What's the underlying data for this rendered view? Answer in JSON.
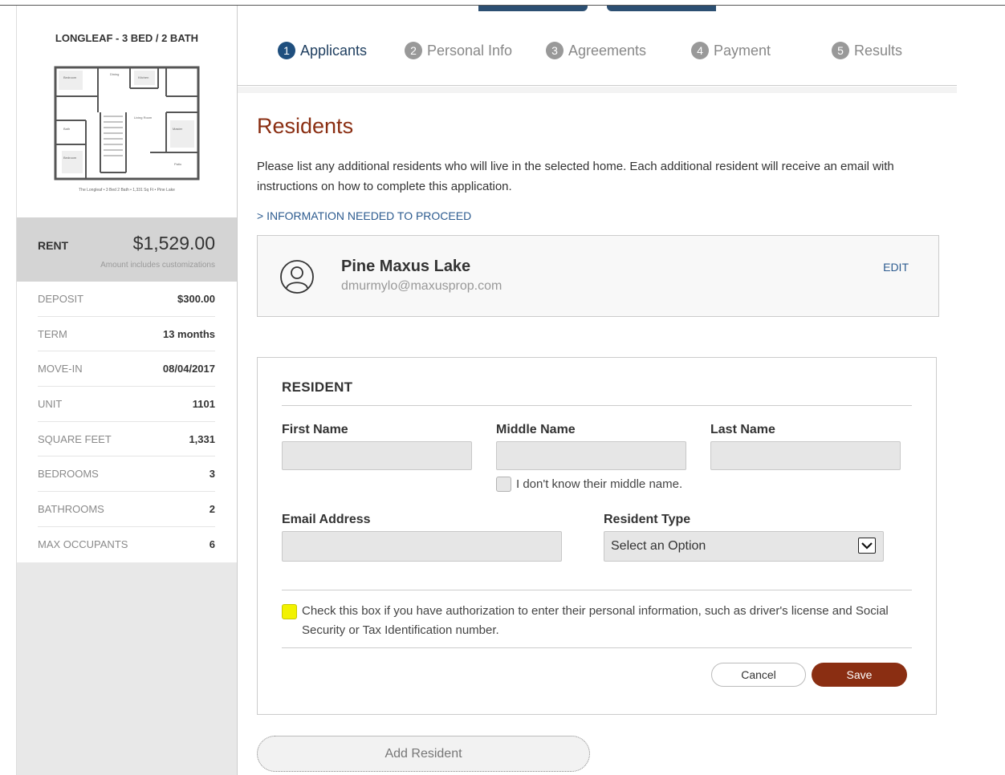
{
  "sidebar": {
    "plan_title": "LONGLEAF - 3 BED / 2 BATH",
    "plan_caption": "The Longleaf • 3 Bed 2 Bath • 1,331 Sq Ft • Pine Lake",
    "rent_label": "RENT",
    "rent_value": "$1,529.00",
    "rent_note": "Amount includes customizations",
    "details": [
      {
        "label": "DEPOSIT",
        "value": "$300.00"
      },
      {
        "label": "TERM",
        "value": "13 months"
      },
      {
        "label": "MOVE-IN",
        "value": "08/04/2017"
      },
      {
        "label": "UNIT",
        "value": "1101"
      },
      {
        "label": "SQUARE FEET",
        "value": "1,331"
      },
      {
        "label": "BEDROOMS",
        "value": "3"
      },
      {
        "label": "BATHROOMS",
        "value": "2"
      },
      {
        "label": "MAX OCCUPANTS",
        "value": "6"
      }
    ]
  },
  "steps": [
    {
      "num": "1",
      "label": "Applicants"
    },
    {
      "num": "2",
      "label": "Personal Info"
    },
    {
      "num": "3",
      "label": "Agreements"
    },
    {
      "num": "4",
      "label": "Payment"
    },
    {
      "num": "5",
      "label": "Results"
    }
  ],
  "main": {
    "heading": "Residents",
    "intro": "Please list any additional residents who will live in the selected home. Each additional resident will receive an email with instructions on how to complete this application.",
    "info_link": "> INFORMATION NEEDED TO PROCEED",
    "card": {
      "name": "Pine Maxus Lake",
      "email": "dmurmylo@maxusprop.com",
      "edit": "EDIT"
    },
    "form": {
      "title": "RESIDENT",
      "first_name_label": "First Name",
      "middle_name_label": "Middle Name",
      "last_name_label": "Last Name",
      "no_middle_label": "I don't know their middle name.",
      "email_label": "Email Address",
      "resident_type_label": "Resident Type",
      "resident_type_value": "Select an Option",
      "auth_text": "Check this box if you have authorization to enter their personal information, such as driver's license and Social Security or Tax Identification number.",
      "cancel": "Cancel",
      "save": "Save"
    },
    "add_resident": "Add Resident"
  },
  "colors": {
    "accent": "#8a2e12",
    "step_active": "#1f4f7e",
    "link": "#2c5b8f",
    "highlight_checkbox": "#f2f200"
  }
}
